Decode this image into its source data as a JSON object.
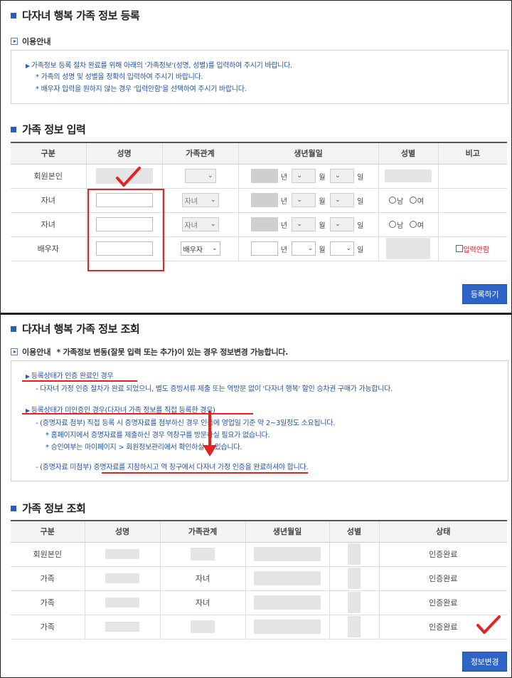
{
  "register": {
    "title": "다자녀 행복 가족 정보 등록",
    "notice_label": "이용안내",
    "notice_lines": [
      "가족정보 등록 절차 완료를 위해 아래의 '가족정보'(성명, 성별)를 입력하여 주시기 바랍니다.",
      "* 가족의 성명 및 성별을 정확히 입력하여 주시기 바랍니다.",
      "* 배우자 입력을 원하지 않는 경우 '입력안함'을 선택하여 주시기 바랍니다."
    ],
    "input_title": "가족 정보 입력",
    "columns": [
      "구분",
      "성명",
      "가족관계",
      "생년월일",
      "성별",
      "비고"
    ],
    "rows": [
      {
        "type": "회원본인",
        "relation": "",
        "gender": ""
      },
      {
        "type": "자녀",
        "relation": "자녀",
        "gender": "radio"
      },
      {
        "type": "자녀",
        "relation": "자녀",
        "gender": "radio"
      },
      {
        "type": "배우자",
        "relation": "배우자",
        "gender": ""
      }
    ],
    "date_units": {
      "year": "년",
      "month": "월",
      "day": "일"
    },
    "gender_options": {
      "male": "남",
      "female": "여"
    },
    "skip_label": "입력안함",
    "submit_label": "등록하기"
  },
  "inquiry": {
    "title": "다자녀 행복 가족 정보 조회",
    "notice_label": "이용안내",
    "notice_note": "* 가족정보 변동(잘못 입력 또는 추가)이 있는 경우 정보변경 가능합니다.",
    "lines": {
      "l1": "등록상태가 인증 완료인 경우",
      "l2": "- 다자녀 가정 인증 절차가 완료 되었으니, 별도 증빙서류 제출 또는 역방문 없이 '다자녀 행복' 할인 승차권 구매가 가능합니다.",
      "l3": "등록상태가 미인증인 경우(다자녀 가족 정보를 직접 등록한 경우)",
      "l4": "- (증명자료 첨부) 직접 등록 시 증명자료를 첨부하신 경우 인증에 영업일 기준 약 2~3일정도 소요됩니다.",
      "l5": "* 홈페이지에서 증명자료를 제출하신 경우 역창구를 방문하실 필요가 없습니다.",
      "l6": "* 승인여부는 마이페이지 > 회원정보관리에서 확인하실 수 있습니다.",
      "l7": "- (증명자료 미첨부) 증명자료를 지참하시고 역 창구에서 다자녀 가정 인증을 완료하셔야 합니다."
    },
    "list_title": "가족 정보 조회",
    "columns": [
      "구분",
      "성명",
      "가족관계",
      "생년월일",
      "성별",
      "상태"
    ],
    "rows": [
      {
        "type": "회원본인",
        "relation": "",
        "status": "인증완료"
      },
      {
        "type": "가족",
        "relation": "자녀",
        "status": "인증완료"
      },
      {
        "type": "가족",
        "relation": "자녀",
        "status": "인증완료"
      },
      {
        "type": "가족",
        "relation": "",
        "status": "인증완료"
      }
    ],
    "change_label": "정보변경"
  },
  "colors": {
    "accent": "#2f64c7",
    "annotation": "#e42222",
    "notice_text": "#2453a3"
  }
}
